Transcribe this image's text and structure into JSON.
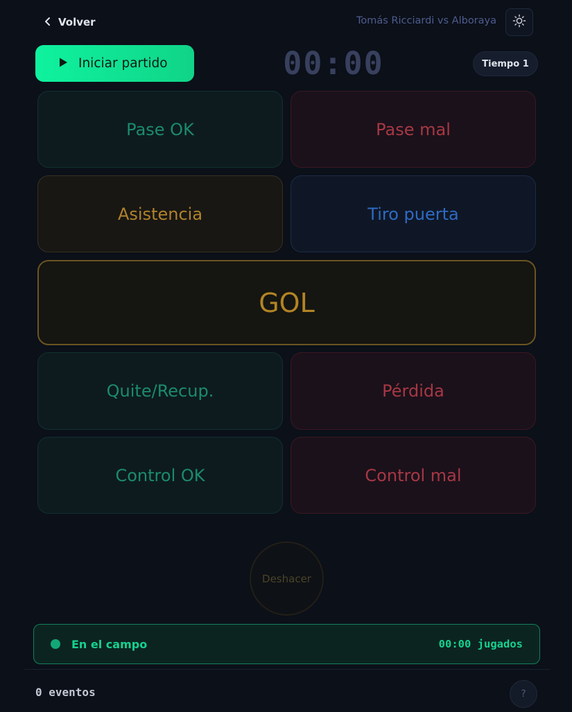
{
  "header": {
    "back_label": "Volver",
    "match_title": "Tomás Ricciardi vs Alboraya",
    "theme_icon": "sun-icon"
  },
  "controls": {
    "start_label": "Iniciar partido",
    "timer": "00:00",
    "period": "Tiempo 1"
  },
  "actions": {
    "pass_ok": "Pase OK",
    "pass_bad": "Pase mal",
    "assist": "Asistencia",
    "shot_on_target": "Tiro puerta",
    "goal": "GOL",
    "tackle": "Quite/Recup.",
    "loss": "Pérdida",
    "control_ok": "Control OK",
    "control_bad": "Control mal"
  },
  "undo_label": "Deshacer",
  "status": {
    "label": "En el campo",
    "played": "00:00 jugados"
  },
  "footer": {
    "events": "0 eventos",
    "help": "?"
  },
  "colors": {
    "accent": "#10e596",
    "positive": "#1b8b6c",
    "negative": "#a63843",
    "assist": "#b0822b",
    "shot": "#2f6ac4",
    "goal": "#b28424"
  }
}
